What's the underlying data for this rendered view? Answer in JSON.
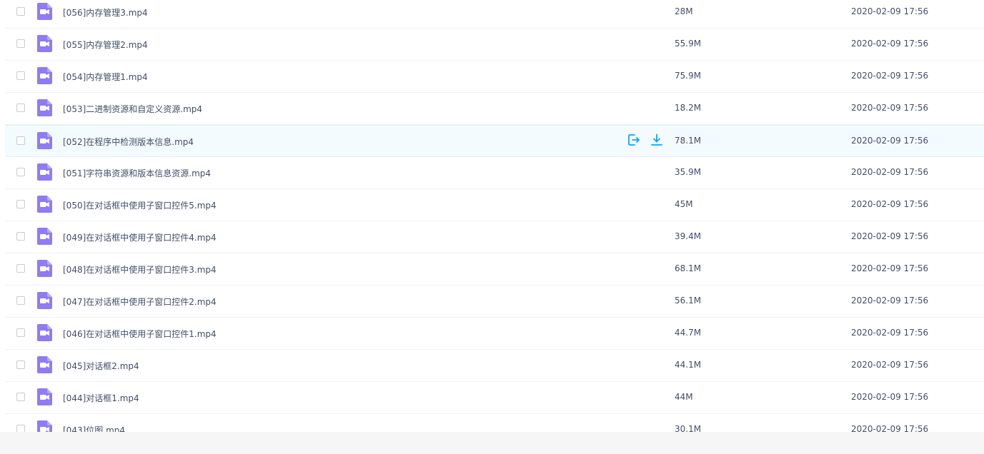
{
  "colors": {
    "accent": "#06a7ff",
    "video_icon": "#8e7cf1",
    "row_hover": "#f4fbff"
  },
  "row_actions": {
    "share_icon": "share-out-icon",
    "download_icon": "download-icon"
  },
  "files": [
    {
      "name": "[056]内存管理3.mp4",
      "size": "28M",
      "modified": "2020-02-09 17:56"
    },
    {
      "name": "[055]内存管理2.mp4",
      "size": "55.9M",
      "modified": "2020-02-09 17:56"
    },
    {
      "name": "[054]内存管理1.mp4",
      "size": "75.9M",
      "modified": "2020-02-09 17:56"
    },
    {
      "name": "[053]二进制资源和自定义资源.mp4",
      "size": "18.2M",
      "modified": "2020-02-09 17:56"
    },
    {
      "name": "[052]在程序中检测版本信息.mp4",
      "size": "78.1M",
      "modified": "2020-02-09 17:56",
      "hovered": true
    },
    {
      "name": "[051]字符串资源和版本信息资源.mp4",
      "size": "35.9M",
      "modified": "2020-02-09 17:56"
    },
    {
      "name": "[050]在对话框中使用子窗口控件5.mp4",
      "size": "45M",
      "modified": "2020-02-09 17:56"
    },
    {
      "name": "[049]在对话框中使用子窗口控件4.mp4",
      "size": "39.4M",
      "modified": "2020-02-09 17:56"
    },
    {
      "name": "[048]在对话框中使用子窗口控件3.mp4",
      "size": "68.1M",
      "modified": "2020-02-09 17:56"
    },
    {
      "name": "[047]在对话框中使用子窗口控件2.mp4",
      "size": "56.1M",
      "modified": "2020-02-09 17:56"
    },
    {
      "name": "[046]在对话框中使用子窗口控件1.mp4",
      "size": "44.7M",
      "modified": "2020-02-09 17:56"
    },
    {
      "name": "[045]对话框2.mp4",
      "size": "44.1M",
      "modified": "2020-02-09 17:56"
    },
    {
      "name": "[044]对话框1.mp4",
      "size": "44M",
      "modified": "2020-02-09 17:56"
    },
    {
      "name": "[043]位图.mp4",
      "size": "30.1M",
      "modified": "2020-02-09 17:56"
    }
  ]
}
